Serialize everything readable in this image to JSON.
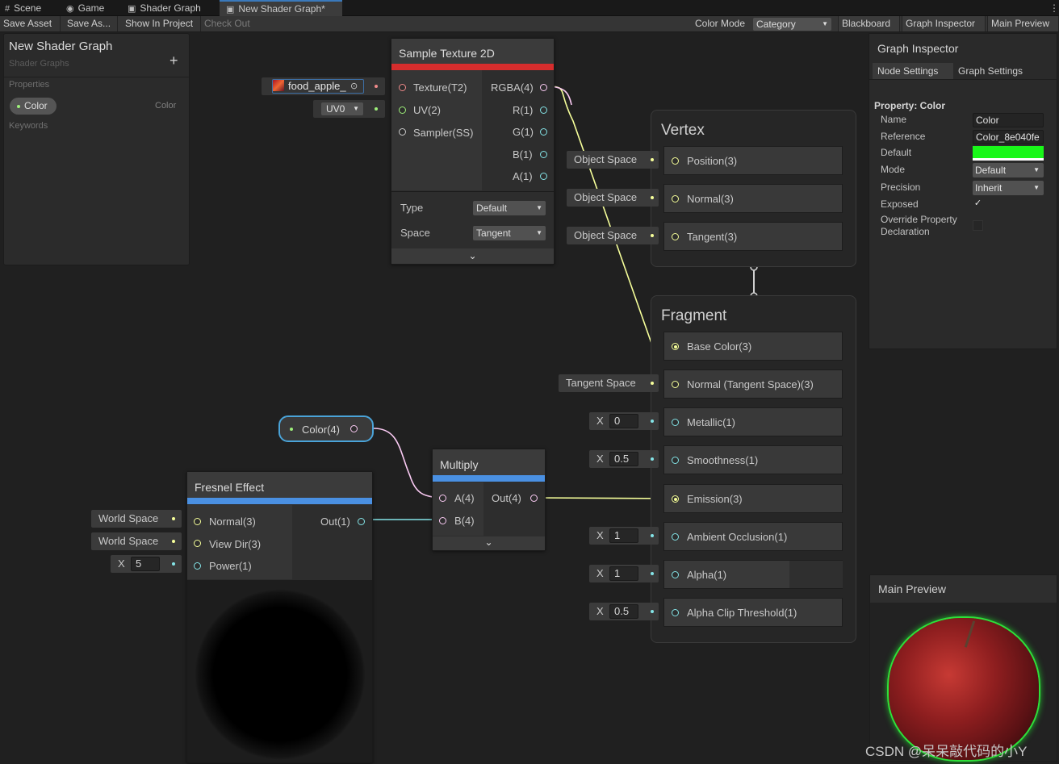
{
  "tabs": [
    {
      "label": "Scene",
      "icon": "hash-icon"
    },
    {
      "label": "Game",
      "icon": "gamepad-icon"
    },
    {
      "label": "Shader Graph",
      "icon": "shader-icon"
    },
    {
      "label": "New Shader Graph*",
      "icon": "shader-icon"
    }
  ],
  "toolbar": {
    "save_asset": "Save Asset",
    "save_as": "Save As...",
    "show_in_project": "Show In Project",
    "check_out": "Check Out",
    "color_mode_label": "Color Mode",
    "color_mode_value": "Category",
    "blackboard": "Blackboard",
    "graph_inspector": "Graph Inspector",
    "main_preview": "Main Preview"
  },
  "blackboard": {
    "title": "New Shader Graph",
    "subtitle": "Shader Graphs",
    "add": "+",
    "properties_label": "Properties",
    "property_name": "Color",
    "property_type": "Color",
    "keywords_label": "Keywords"
  },
  "sample_texture": {
    "title": "Sample Texture 2D",
    "texture_value": "food_apple_",
    "uv_value": "UV0",
    "inputs": [
      "Texture(T2)",
      "UV(2)",
      "Sampler(SS)"
    ],
    "outputs": [
      "RGBA(4)",
      "R(1)",
      "G(1)",
      "B(1)",
      "A(1)"
    ],
    "type_label": "Type",
    "type_value": "Default",
    "space_label": "Space",
    "space_value": "Tangent"
  },
  "vertex": {
    "title": "Vertex",
    "blocks": [
      {
        "label": "Position(3)",
        "input": "Object Space"
      },
      {
        "label": "Normal(3)",
        "input": "Object Space"
      },
      {
        "label": "Tangent(3)",
        "input": "Object Space"
      }
    ]
  },
  "fragment": {
    "title": "Fragment",
    "blocks": [
      {
        "label": "Base Color(3)",
        "input": ""
      },
      {
        "label": "Normal (Tangent Space)(3)",
        "input": "Tangent Space"
      },
      {
        "label": "Metallic(1)",
        "x": "X",
        "value": "0"
      },
      {
        "label": "Smoothness(1)",
        "x": "X",
        "value": "0.5"
      },
      {
        "label": "Emission(3)",
        "input": ""
      },
      {
        "label": "Ambient Occlusion(1)",
        "x": "X",
        "value": "1"
      },
      {
        "label": "Alpha(1)",
        "x": "X",
        "value": "1"
      },
      {
        "label": "Alpha Clip Threshold(1)",
        "x": "X",
        "value": "0.5"
      }
    ]
  },
  "color_property_node": {
    "label": "Color(4)"
  },
  "multiply": {
    "title": "Multiply",
    "inputs": [
      "A(4)",
      "B(4)"
    ],
    "output": "Out(4)"
  },
  "fresnel": {
    "title": "Fresnel Effect",
    "inputs": [
      "Normal(3)",
      "View Dir(3)",
      "Power(1)"
    ],
    "output": "Out(1)",
    "normal_input": "World Space",
    "view_input": "World Space",
    "power_x": "X",
    "power_value": "5"
  },
  "graph_inspector": {
    "title": "Graph Inspector",
    "tab_node": "Node Settings",
    "tab_graph": "Graph Settings",
    "section": "Property: Color",
    "name_label": "Name",
    "name_value": "Color",
    "reference_label": "Reference",
    "reference_value": "Color_8e040fe",
    "default_label": "Default",
    "default_color": "#19f719",
    "mode_label": "Mode",
    "mode_value": "Default",
    "precision_label": "Precision",
    "precision_value": "Inherit",
    "exposed_label": "Exposed",
    "exposed_check": "✓",
    "override_label_1": "Override Property",
    "override_label_2": "Declaration"
  },
  "main_preview": {
    "title": "Main Preview"
  },
  "watermark": "CSDN @呆呆敲代码的小Y",
  "colors": {
    "texture": "#f08b8b",
    "vector2": "#9ef07a",
    "vector3": "#f6ff9a",
    "vector1": "#84e4e7",
    "vector4": "#fbcbf4",
    "sampler": "#cccccc",
    "category_color": "#d62d2d",
    "category_math": "#4a90e2"
  }
}
